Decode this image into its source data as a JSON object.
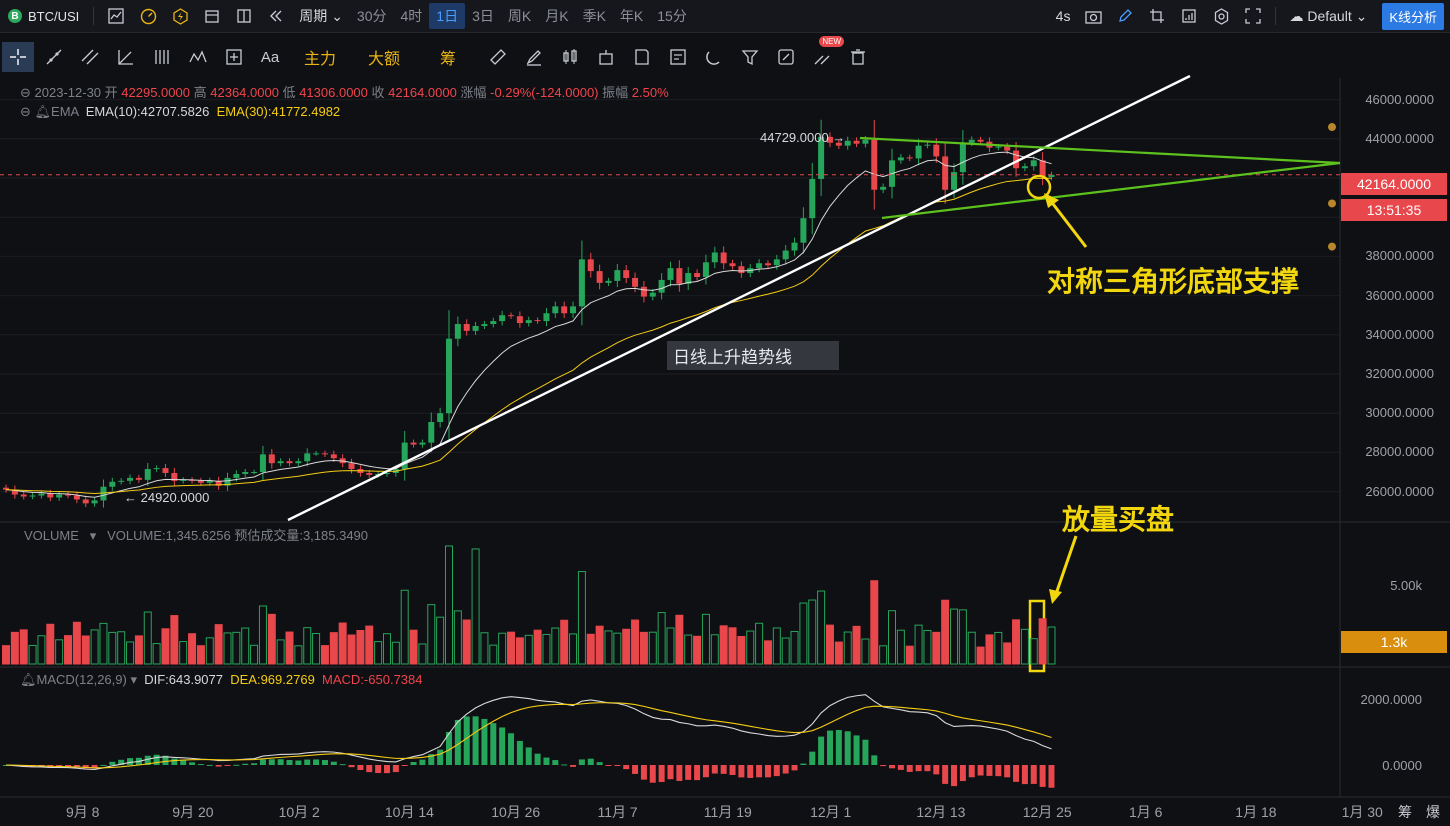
{
  "topbar": {
    "symbol": "BTC/USI",
    "period_label": "周期",
    "timeframes": [
      "30分",
      "4时",
      "1日",
      "3日",
      "周K",
      "月K",
      "季K",
      "年K",
      "15分"
    ],
    "active_timeframe": "1日",
    "refresh": "4s",
    "theme": "Default",
    "analysis_button": "K线分析"
  },
  "drawbar": {
    "text_tool": "Aa",
    "main_force": "主力",
    "big_amount": "大额",
    "chips": "筹",
    "new_badge": "NEW"
  },
  "ohlc": {
    "date": "2023-12-30",
    "open_label": "开",
    "open": "42295.0000",
    "high_label": "高",
    "high": "42364.0000",
    "low_label": "低",
    "low": "41306.0000",
    "close_label": "收",
    "close": "42164.0000",
    "change_label": "涨幅",
    "change": "-0.29%(-124.0000)",
    "amp_label": "振幅",
    "amp": "2.50%"
  },
  "ema": {
    "name": "EMA",
    "ema10": "EMA(10):42707.5826",
    "ema30": "EMA(30):41772.4982"
  },
  "volume": {
    "name": "VOLUME",
    "value": "VOLUME:1,345.6256",
    "estimate": "预估成交量:3,185.3490",
    "axis": "5.00k",
    "current": "1.3k"
  },
  "macd": {
    "name": "MACD(12,26,9)",
    "dif": "DIF:643.9077",
    "dea": "DEA:969.2769",
    "macd": "MACD:-650.7384",
    "axis": [
      "2000.0000",
      "0.0000"
    ]
  },
  "price_axis": [
    "46000.0000",
    "44000.0000",
    "42000.0000",
    "40000.0000",
    "38000.0000",
    "36000.0000",
    "34000.0000",
    "32000.0000",
    "30000.0000",
    "28000.0000",
    "26000.0000"
  ],
  "current_price": "42164.0000",
  "countdown": "13:51:35",
  "high_marker": "44729.0000 →",
  "low_marker": "← 24920.0000",
  "x_axis": [
    "9月 8",
    "9月 20",
    "10月 2",
    "10月 14",
    "10月 26",
    "11月 7",
    "11月 19",
    "12月 1",
    "12月 13",
    "12月 25",
    "1月 6",
    "1月 18",
    "1月 30"
  ],
  "corner": [
    "筹",
    "爆"
  ],
  "annotations": {
    "triangle": "对称三角形底部支撑",
    "trendline": "日线上升趋势线",
    "volume": "放量买盘"
  },
  "colors": {
    "up": "#26a65b",
    "down": "#e8474b",
    "ema10": "#d9d9d9",
    "ema30": "#f4cc13",
    "trend": "#ffffff",
    "triangle": "#5dc21e",
    "annot": "#f2d70e"
  },
  "chart_data": {
    "type": "candlestick",
    "price_range": [
      24500,
      47000
    ],
    "start_date": "2023-09-01",
    "closes": [
      26100,
      25850,
      25750,
      25800,
      25900,
      25700,
      25850,
      25800,
      25600,
      25400,
      25550,
      26250,
      26500,
      26550,
      26700,
      26600,
      27150,
      27200,
      26950,
      26550,
      26600,
      26550,
      26450,
      26550,
      26300,
      26700,
      26900,
      27000,
      27000,
      27900,
      27450,
      27550,
      27450,
      27550,
      27950,
      27950,
      27900,
      27700,
      27450,
      27150,
      26950,
      26850,
      26900,
      26950,
      27150,
      28500,
      28400,
      28500,
      29550,
      30000,
      33800,
      34550,
      34200,
      34450,
      34550,
      34700,
      35000,
      34950,
      34600,
      34750,
      34700,
      35100,
      35450,
      35100,
      35450,
      37850,
      37250,
      36650,
      36750,
      37300,
      36900,
      36450,
      35950,
      36150,
      36800,
      37400,
      36600,
      37150,
      36950,
      37700,
      38200,
      37650,
      37500,
      37150,
      37400,
      37650,
      37550,
      37850,
      38300,
      38700,
      39950,
      41950,
      44100,
      43800,
      43650,
      43900,
      43750,
      43950,
      41400,
      41550,
      42900,
      43050,
      43000,
      43650,
      43700,
      43100,
      41400,
      42300,
      43800,
      43950,
      43850,
      43550,
      43600,
      43400,
      42500,
      42600,
      42900,
      42050,
      42164
    ]
  }
}
